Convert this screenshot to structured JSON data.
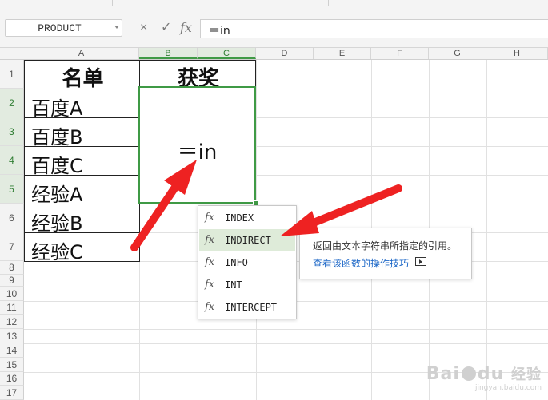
{
  "formula_bar": {
    "name_box": "PRODUCT",
    "cancel_icon": "×",
    "enter_icon": "✓",
    "fx_icon": "fx",
    "formula": "＝in"
  },
  "columns": [
    "A",
    "B",
    "C",
    "D",
    "E",
    "F",
    "G",
    "H"
  ],
  "rows": [
    "1",
    "2",
    "3",
    "4",
    "5",
    "6",
    "7",
    "8",
    "9",
    "10",
    "11",
    "12",
    "13",
    "14",
    "15",
    "16",
    "17"
  ],
  "cells": {
    "A1": "名单",
    "BC1": "获奖",
    "A2": "百度A",
    "A3": "百度B",
    "A4": "百度C",
    "A5": "经验A",
    "A6": "经验B",
    "A7": "经验C",
    "BC2_5": "＝in"
  },
  "autocomplete": {
    "items": [
      "INDEX",
      "INDIRECT",
      "INFO",
      "INT",
      "INTERCEPT"
    ],
    "selected": "INDIRECT",
    "icon": "fx",
    "tooltip_desc": "返回由文本字符串所指定的引用。",
    "tooltip_link": "查看该函数的操作技巧"
  },
  "watermark": {
    "text_left": "Bai",
    "text_right": "经验",
    "text_mid": "du",
    "url": "jingyan.baidu.com"
  },
  "colors": {
    "selection": "#3f9a45",
    "arrow": "#ee2222",
    "link": "#1c67c7"
  }
}
